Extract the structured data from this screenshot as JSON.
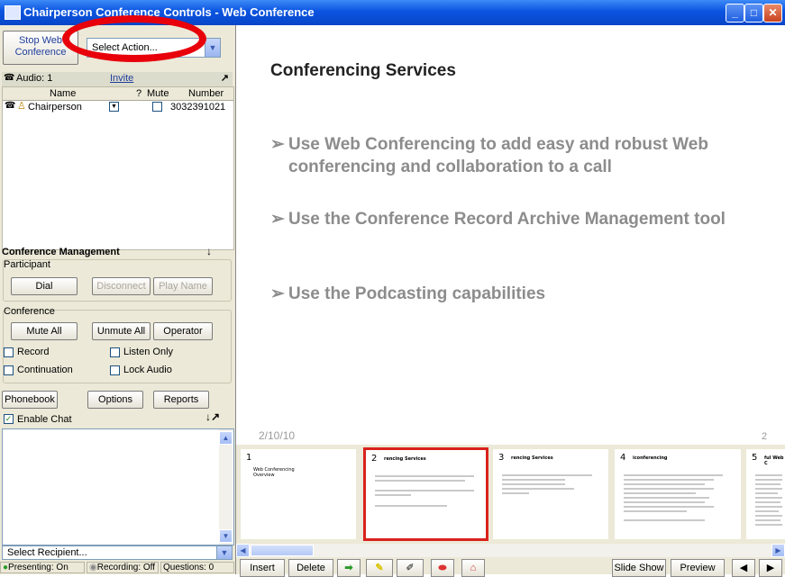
{
  "window": {
    "title": "Chairperson Conference Controls - Web Conference"
  },
  "top": {
    "stop_button": "Stop Web Conference",
    "action_select": "Select Action..."
  },
  "participants": {
    "audio_label": "Audio: 1",
    "invite_label": "Invite",
    "columns": [
      "Name",
      "?",
      "Mute",
      "Number"
    ],
    "rows": [
      {
        "name": "Chairperson",
        "number": "3032391021"
      }
    ]
  },
  "management": {
    "title": "Conference Management",
    "participant_label": "Participant",
    "dial": "Dial",
    "disconnect": "Disconnect",
    "play_name": "Play Name",
    "conference_label": "Conference",
    "mute_all": "Mute All",
    "unmute_all": "Unmute All",
    "operator": "Operator",
    "record": "Record",
    "listen_only": "Listen Only",
    "continuation": "Continuation",
    "lock_audio": "Lock Audio",
    "phonebook": "Phonebook",
    "options": "Options",
    "reports": "Reports"
  },
  "chat": {
    "enable_label": "Enable Chat",
    "recipient": "Select Recipient..."
  },
  "status": {
    "presenting": "Presenting: On",
    "recording": "Recording: Off",
    "questions": "Questions: 0"
  },
  "slide": {
    "title": "Conferencing Services",
    "bullets": [
      "Use Web Conferencing to add easy and robust Web conferencing and collaboration to a call",
      "Use the Conference Record Archive Management tool",
      "Use the Podcasting capabilities"
    ],
    "date": "2/10/10",
    "page": "2"
  },
  "thumbnails": [
    {
      "num": "1",
      "title": "Web Conferencing Overview"
    },
    {
      "num": "2",
      "title": "rencing Services"
    },
    {
      "num": "3",
      "title": "rencing Services"
    },
    {
      "num": "4",
      "title": "iconferencing"
    },
    {
      "num": "5",
      "title": "ful Web C"
    }
  ],
  "toolbar": {
    "insert": "Insert",
    "delete": "Delete",
    "slide_show": "Slide Show",
    "preview": "Preview"
  },
  "colors": {
    "selection": "#d9221c",
    "annotation_circle": "#e8000b",
    "title_bar": "#0a54e0"
  }
}
